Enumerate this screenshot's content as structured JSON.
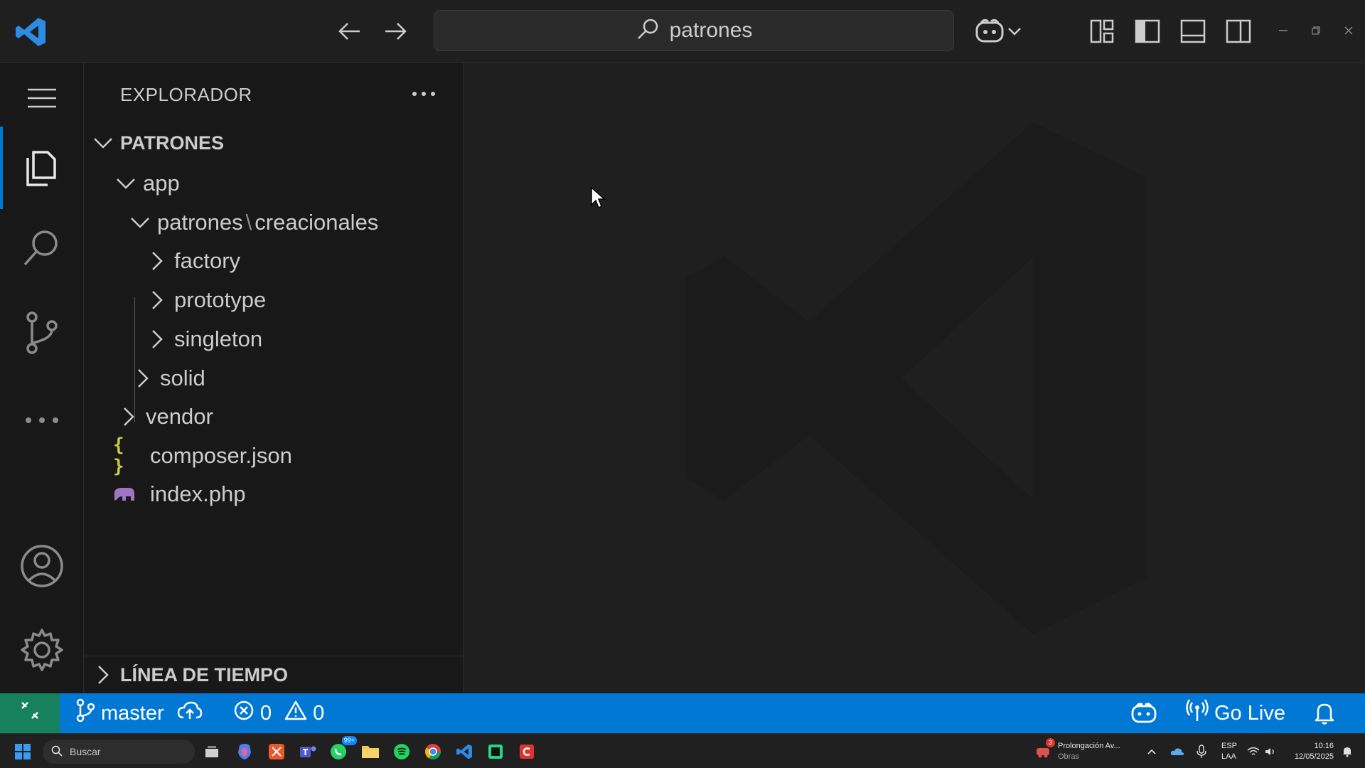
{
  "titlebar": {
    "search_text": "patrones",
    "icons": [
      "back-arrow-icon",
      "forward-arrow-icon",
      "search-icon",
      "copilot-icon",
      "chevron-down-icon",
      "customize-layout-icon",
      "toggle-primary-sidebar-icon",
      "toggle-panel-icon",
      "toggle-secondary-sidebar-icon",
      "minimize-icon",
      "restore-icon",
      "close-icon"
    ]
  },
  "activitybar": {
    "items": [
      "menu-icon",
      "explorer-icon",
      "search-icon",
      "source-control-icon",
      "more-icon",
      "accounts-icon",
      "settings-gear-icon"
    ]
  },
  "sidebar": {
    "title": "EXPLORADOR",
    "root": "PATRONES",
    "tree": {
      "app": "app",
      "patrones_creacionales": "patrones",
      "sep": "\\",
      "creacionales": "creacionales",
      "factory": "factory",
      "prototype": "prototype",
      "singleton": "singleton",
      "solid": "solid",
      "vendor": "vendor",
      "composer": "composer.json",
      "index": "index.php",
      "json_icon_text": "{ }"
    },
    "timeline": "LÍNEA DE TIEMPO"
  },
  "statusbar": {
    "branch": "master",
    "errors": "0",
    "warnings": "0",
    "go_live": "Go Live"
  },
  "taskbar": {
    "search_placeholder": "Buscar",
    "whatsapp_badge": "99+",
    "notification_title": "Prolongación Av...",
    "notification_sub": "Obras",
    "notification_badge": "3",
    "lang1": "ESP",
    "lang2": "LAA",
    "time": "10:16",
    "date": "12/05/2025"
  },
  "colors": {
    "accent": "#0078d4",
    "remote": "#16825d",
    "json_icon": "#cbcb41",
    "php_icon": "#a074c4"
  }
}
